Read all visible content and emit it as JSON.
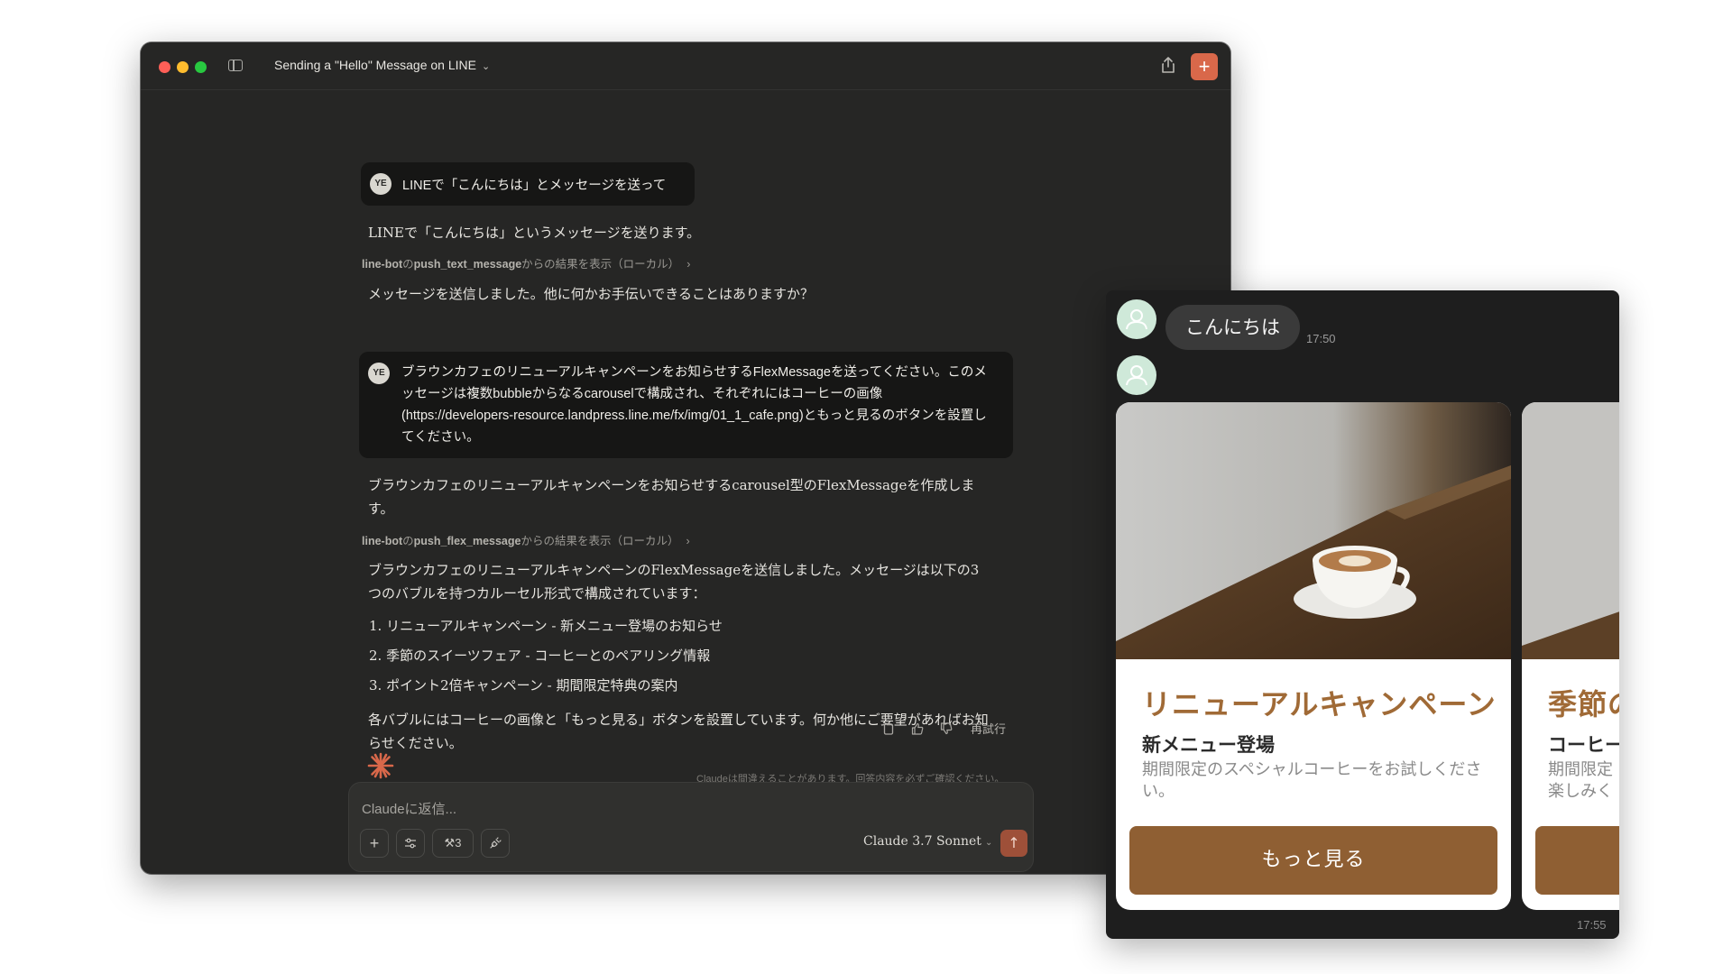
{
  "window": {
    "title": "Sending a \"Hello\" Message on LINE",
    "new_chat_label": "+"
  },
  "conversation": {
    "user_message_1": {
      "avatar": "YE",
      "text": "LINEで「こんにちは」とメッセージを送って"
    },
    "assistant_1": {
      "text": "LINEで「こんにちは」というメッセージを送ります。",
      "tool_prefix": "line-bot",
      "tool_connector": "の",
      "tool_name": "push_text_message",
      "tool_suffix": "からの結果を表示（ローカル）",
      "result": "メッセージを送信しました。他に何かお手伝いできることはありますか？"
    },
    "user_message_2": {
      "avatar": "YE",
      "text": "ブラウンカフェのリニューアルキャンペーンをお知らせするFlexMessageを送ってください。このメッセージは複数bubbleからなるcarouselで構成され、それぞれにはコーヒーの画像(https://developers-resource.landpress.line.me/fx/img/01_1_cafe.png)ともっと見るのボタンを設置してください。"
    },
    "assistant_2": {
      "intro": "ブラウンカフェのリニューアルキャンペーンをお知らせするcarousel型のFlexMessageを作成します。",
      "tool_prefix": "line-bot",
      "tool_connector": "の",
      "tool_name": "push_flex_message",
      "tool_suffix": "からの結果を表示（ローカル）",
      "result": "ブラウンカフェのリニューアルキャンペーンのFlexMessageを送信しました。メッセージは以下の3つのバブルを持つカルーセル形式で構成されています：",
      "list": [
        "1. リニューアルキャンペーン - 新メニュー登場のお知らせ",
        "2. 季節のスイーツフェア - コーヒーとのペアリング情報",
        "3. ポイント2倍キャンペーン - 期間限定特典の案内"
      ],
      "closing": "各バブルにはコーヒーの画像と「もっと見る」ボタンを設置しています。何か他にご要望があればお知らせください。"
    },
    "message_actions": {
      "retry_label": "再試行"
    },
    "disclaimer": "Claudeは間違えることがあります。回答内容を必ずご確認ください。"
  },
  "composer": {
    "placeholder": "Claudeに返信...",
    "tools_count": "3",
    "model": "Claude 3.7 Sonnet"
  },
  "line_chat": {
    "bubble_text": "こんにちは",
    "bubble_time": "17:50",
    "cards": [
      {
        "title": "リニューアルキャンペーン",
        "subtitle": "新メニュー登場",
        "description": "期間限定のスペシャルコーヒーをお試しください。",
        "button": "もっと見る"
      },
      {
        "title": "季節の",
        "subtitle": "コーヒー",
        "description": "期間限定 楽しみく"
      }
    ],
    "footer_time": "17:55"
  },
  "colors": {
    "accent": "#d9684a",
    "card_title": "#a06a36",
    "card_button": "#8f5f33"
  }
}
